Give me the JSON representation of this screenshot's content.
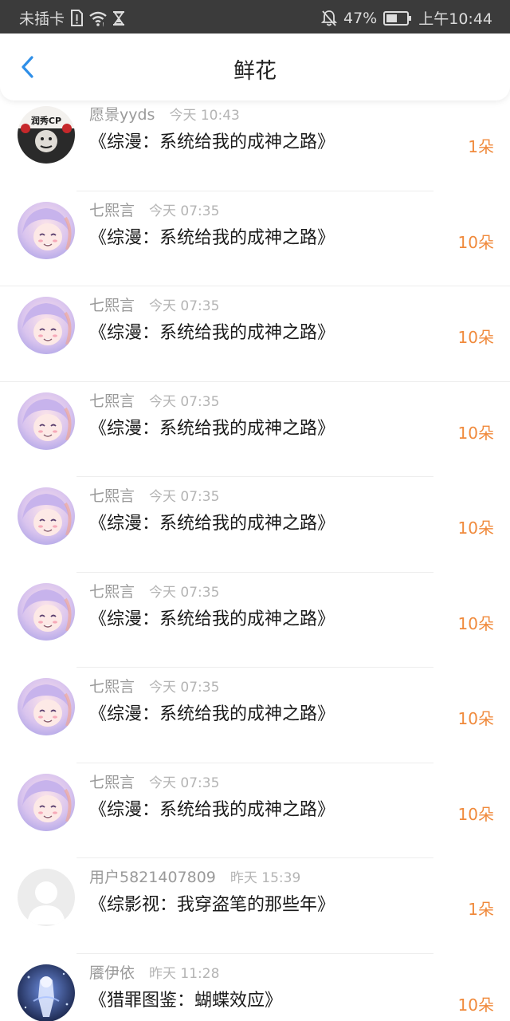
{
  "status_bar": {
    "carrier": "未插卡",
    "battery_percent": "47%",
    "time": "上午10:44"
  },
  "nav": {
    "title": "鲜花"
  },
  "avatars": {
    "yuanjing": {
      "text_top": "润秀CP"
    },
    "qixiyan": {},
    "default": {},
    "yanyiyi": {}
  },
  "rows": [
    {
      "username": "愿景yyds",
      "time": "今天 10:43",
      "book": "《综漫：系统给我的成神之路》",
      "count": "1朵",
      "avatar": "yuanjing"
    },
    {
      "username": "七熙言",
      "time": "今天 07:35",
      "book": "《综漫：系统给我的成神之路》",
      "count": "10朵",
      "avatar": "qixiyan"
    },
    {
      "username": "七熙言",
      "time": "今天 07:35",
      "book": "《综漫：系统给我的成神之路》",
      "count": "10朵",
      "avatar": "qixiyan"
    },
    {
      "username": "七熙言",
      "time": "今天 07:35",
      "book": "《综漫：系统给我的成神之路》",
      "count": "10朵",
      "avatar": "qixiyan"
    },
    {
      "username": "七熙言",
      "time": "今天 07:35",
      "book": "《综漫：系统给我的成神之路》",
      "count": "10朵",
      "avatar": "qixiyan"
    },
    {
      "username": "七熙言",
      "time": "今天 07:35",
      "book": "《综漫：系统给我的成神之路》",
      "count": "10朵",
      "avatar": "qixiyan"
    },
    {
      "username": "七熙言",
      "time": "今天 07:35",
      "book": "《综漫：系统给我的成神之路》",
      "count": "10朵",
      "avatar": "qixiyan"
    },
    {
      "username": "七熙言",
      "time": "今天 07:35",
      "book": "《综漫：系统给我的成神之路》",
      "count": "10朵",
      "avatar": "qixiyan"
    },
    {
      "username": "用户5821407809",
      "time": "昨天 15:39",
      "book": "《综影视：我穿盗笔的那些年》",
      "count": "1朵",
      "avatar": "default"
    },
    {
      "username": "餍伊依",
      "time": "昨天 11:28",
      "book": "《猎罪图鉴：蝴蝶效应》",
      "count": "10朵",
      "avatar": "yanyiyi"
    }
  ],
  "colors": {
    "accent_blue": "#2f8fe8",
    "count_orange": "#f08a3c",
    "status_bar_bg": "#3b3b3b"
  },
  "icons": [
    "back-arrow-icon",
    "sim-missing-icon",
    "wifi-icon",
    "hourglass-icon",
    "notifications-off-icon",
    "battery-icon"
  ]
}
